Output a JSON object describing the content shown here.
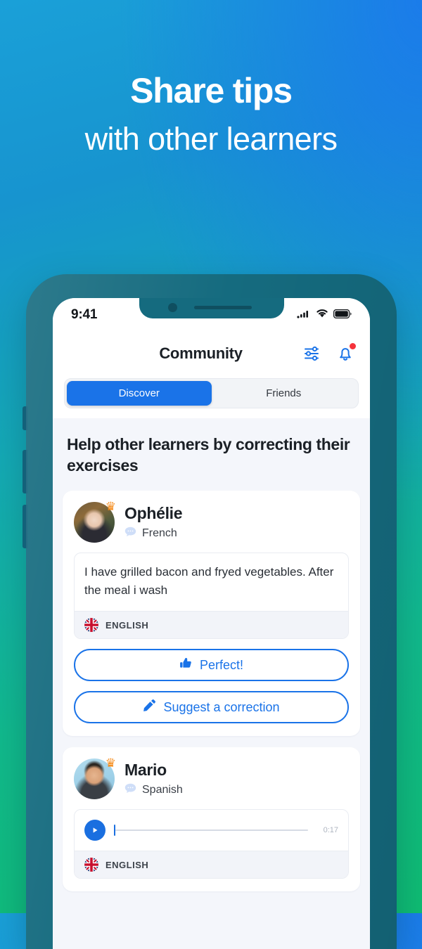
{
  "hero": {
    "line1": "Share tips",
    "line2": "with other learners"
  },
  "phone": {
    "status_bar": {
      "time": "9:41",
      "icons": [
        "cellular-signal-icon",
        "wifi-icon",
        "battery-icon"
      ]
    },
    "header": {
      "title": "Community",
      "filter_icon": "sliders-icon",
      "notifications_icon": "bell-icon",
      "notification_badge": true
    },
    "segmented": {
      "tabs": [
        {
          "label": "Discover",
          "active": true
        },
        {
          "label": "Friends",
          "active": false
        }
      ]
    },
    "section_title": "Help other learners by correcting their exercises",
    "posts": [
      {
        "name": "Ophélie",
        "language": "French",
        "language_icon": "speech-bubble-icon",
        "crown": true,
        "type": "text",
        "exercise_text": "I have grilled bacon and fryed vegetables. After the meal i wash",
        "exercise_language": "ENGLISH",
        "exercise_flag": "uk-flag-icon",
        "actions": [
          {
            "label": "Perfect!",
            "icon": "thumbs-up-icon"
          },
          {
            "label": "Suggest a correction",
            "icon": "pencil-icon"
          }
        ]
      },
      {
        "name": "Mario",
        "language": "Spanish",
        "language_icon": "speech-bubble-icon",
        "crown": true,
        "type": "audio",
        "audio": {
          "play_icon": "play-icon",
          "duration": "0:17",
          "progress": 0
        },
        "exercise_language": "ENGLISH",
        "exercise_flag": "uk-flag-icon"
      }
    ]
  },
  "colors": {
    "accent_blue": "#1a73e8",
    "badge_red": "#f5323b",
    "crown_orange": "#f58a18",
    "phone_frame": "#156b7f",
    "screen_bg": "#f4f6fb"
  }
}
